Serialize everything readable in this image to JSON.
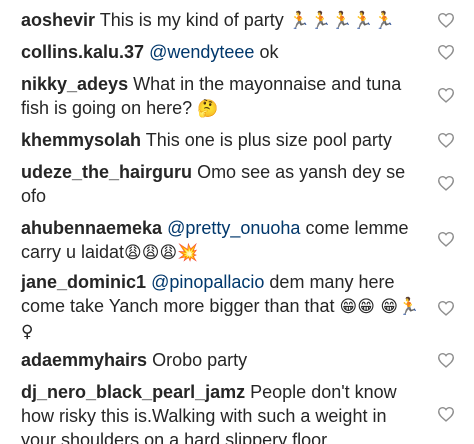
{
  "comments": [
    {
      "username": "aoshevir",
      "mention": "",
      "text": "This is my kind of party",
      "emoji": "🏃🏃🏃🏃🏃"
    },
    {
      "username": "collins.kalu.37",
      "mention": "@wendyteee",
      "text": "ok",
      "emoji": ""
    },
    {
      "username": "nikky_adeys",
      "mention": "",
      "text": "What in the mayonnaise and tuna fish is going on here?",
      "emoji": "🤔"
    },
    {
      "username": "khemmysolah",
      "mention": "",
      "text": "This one is plus size pool party",
      "emoji": ""
    },
    {
      "username": "udeze_the_hairguru",
      "mention": "",
      "text": "Omo see as yansh dey se ofo",
      "emoji": ""
    },
    {
      "username": "ahubennaemeka",
      "mention": "@pretty_onuoha",
      "text": "come lemme carry u laidat",
      "emoji": "😩😩😩💥"
    },
    {
      "username": "jane_dominic1",
      "mention": "@pinopallacio",
      "text": "dem many here come take Yanch more bigger than that",
      "emoji": "😁😁 😁🏃♀"
    },
    {
      "username": "adaemmyhairs",
      "mention": "",
      "text": "Orobo party",
      "emoji": ""
    },
    {
      "username": "dj_nero_black_pearl_jamz",
      "mention": "",
      "text": "People don't know how risky this is.Walking with such a weight in your shoulders on a hard slippery floor.",
      "emoji": ""
    }
  ],
  "icons": {
    "like": "heart-outline-icon"
  },
  "colors": {
    "text": "#262626",
    "mention": "#00376b",
    "heart_stroke": "#8e8e8e"
  }
}
